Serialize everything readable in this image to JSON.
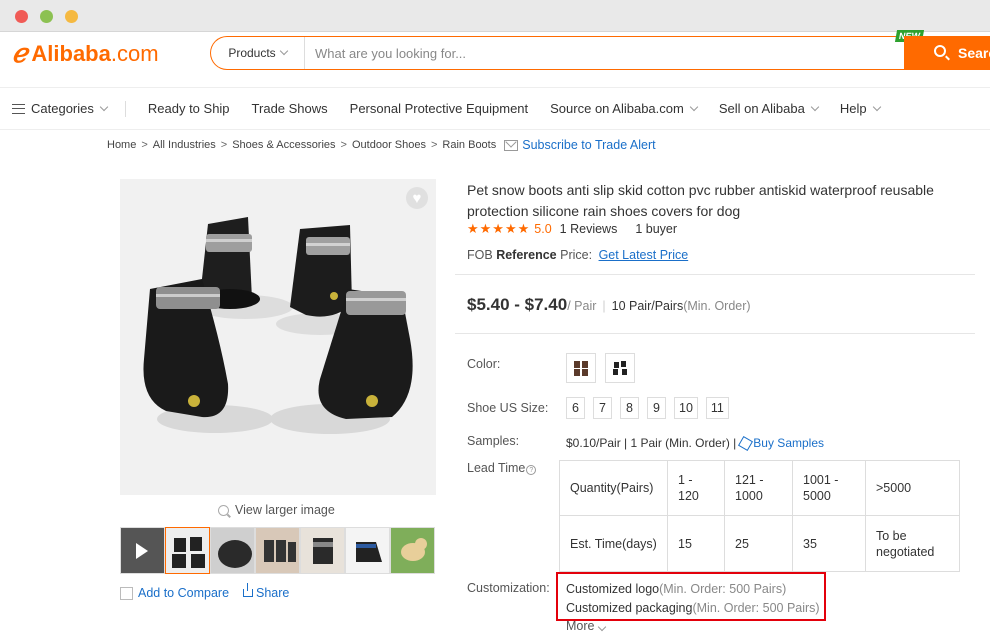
{
  "header": {
    "logo_text": "Alibaba",
    "logo_suffix": ".com",
    "search_category": "Products",
    "search_placeholder": "What are you looking for...",
    "search_button": "Search",
    "new_badge": "NEW"
  },
  "nav": {
    "categories": "Categories",
    "items": [
      "Ready to Ship",
      "Trade Shows",
      "Personal Protective Equipment",
      "Source on Alibaba.com",
      "Sell on Alibaba",
      "Help"
    ]
  },
  "breadcrumb": {
    "items": [
      "Home",
      "All Industries",
      "Shoes & Accessories",
      "Outdoor Shoes",
      "Rain Boots"
    ],
    "subscribe": "Subscribe to Trade Alert"
  },
  "gallery": {
    "view_larger": "View larger image",
    "add_to_compare": "Add to Compare",
    "share": "Share"
  },
  "product": {
    "title": "Pet snow boots anti slip skid cotton pvc rubber antiskid waterproof reusable protection silicone rain shoes covers for dog",
    "stars": "★★★★★",
    "score": "5.0",
    "reviews": "1 Reviews",
    "buyers": "1 buyer",
    "fob_prefix": "FOB",
    "fob_bold": "Reference",
    "fob_suffix": "Price:",
    "fob_link": "Get Latest Price",
    "price": "$5.40 - $7.40",
    "price_unit": "/ Pair",
    "min_order_qty": "10 Pair/Pairs",
    "min_order_label": "(Min. Order)"
  },
  "attributes": {
    "color_label": "Color:",
    "size_label": "Shoe US Size:",
    "sizes": [
      "6",
      "7",
      "8",
      "9",
      "10",
      "11"
    ],
    "samples_label": "Samples:",
    "samples_value": "$0.10/Pair | 1 Pair (Min. Order) |",
    "buy_samples": "Buy Samples",
    "lead_time_label": "Lead Time",
    "lead_table": {
      "row1": [
        "Quantity(Pairs)",
        "1 - 120",
        "121 - 1000",
        "1001 - 5000",
        ">5000"
      ],
      "row2": [
        "Est. Time(days)",
        "15",
        "25",
        "35",
        "To be negotiated"
      ]
    },
    "customization_label": "Customization:",
    "customization": [
      {
        "name": "Customized logo",
        "moq": "(Min. Order: 500 Pairs)"
      },
      {
        "name": "Customized packaging",
        "moq": "(Min. Order: 500 Pairs)"
      }
    ],
    "more": "More"
  },
  "colors": {
    "accent": "#ff6a00",
    "link": "#1a6fc9",
    "highlight_border": "#e3000b"
  }
}
